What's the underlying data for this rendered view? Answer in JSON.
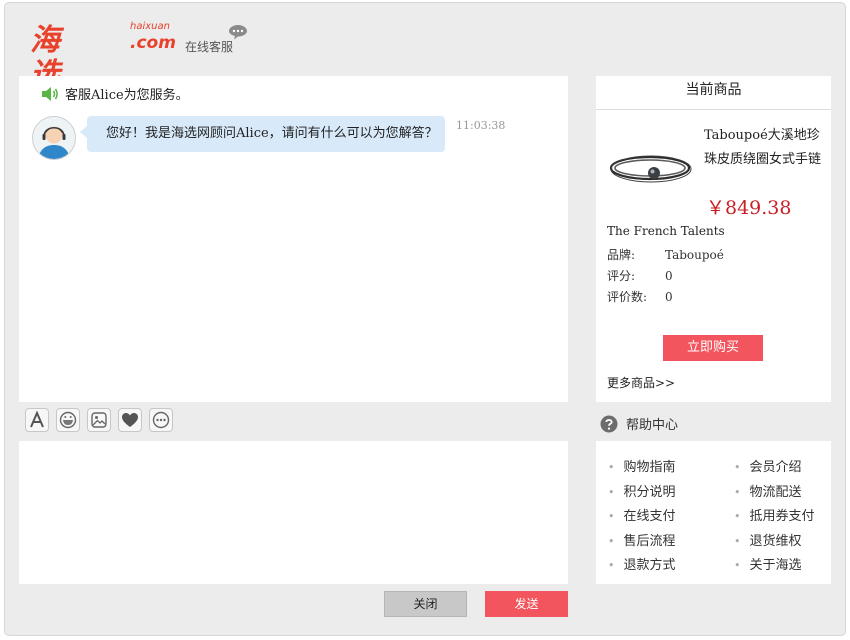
{
  "header": {
    "logo_main": "海选",
    "logo_sub": "haixuan",
    "logo_com": ".com",
    "service_label": "在线客服"
  },
  "chat": {
    "notice": "客服Alice为您服务。",
    "messages": [
      {
        "text": "您好！我是海选网顾问Alice，请问有什么可以为您解答？",
        "time": "11:03:38"
      }
    ]
  },
  "toolbar": {
    "icons": [
      "font-icon",
      "emoji-icon",
      "image-icon",
      "heart-icon",
      "more-icon"
    ]
  },
  "input": {
    "value": "",
    "placeholder": ""
  },
  "actions": {
    "close_label": "关闭",
    "send_label": "发送"
  },
  "product": {
    "header": "当前商品",
    "name": "Taboupoé大溪地珍珠皮质绕圈女式手链",
    "price": "￥849.38",
    "store": "The French Talents",
    "attributes": [
      {
        "key": "品牌:",
        "value": "Taboupoé"
      },
      {
        "key": "评分:",
        "value": "0"
      },
      {
        "key": "评价数:",
        "value": "0"
      }
    ],
    "buy_label": "立即购买",
    "more_label": "更多商品>>"
  },
  "help": {
    "title": "帮助中心",
    "items": [
      {
        "label": "购物指南"
      },
      {
        "label": "会员介绍"
      },
      {
        "label": "积分说明"
      },
      {
        "label": "物流配送"
      },
      {
        "label": "在线支付"
      },
      {
        "label": "抵用券支付"
      },
      {
        "label": "售后流程"
      },
      {
        "label": "退货维权"
      },
      {
        "label": "退款方式"
      },
      {
        "label": "关于海选"
      }
    ]
  },
  "colors": {
    "brand": "#e8412c",
    "accent": "#f2555d",
    "price": "#c81e24",
    "bubble": "#d8eafa"
  }
}
